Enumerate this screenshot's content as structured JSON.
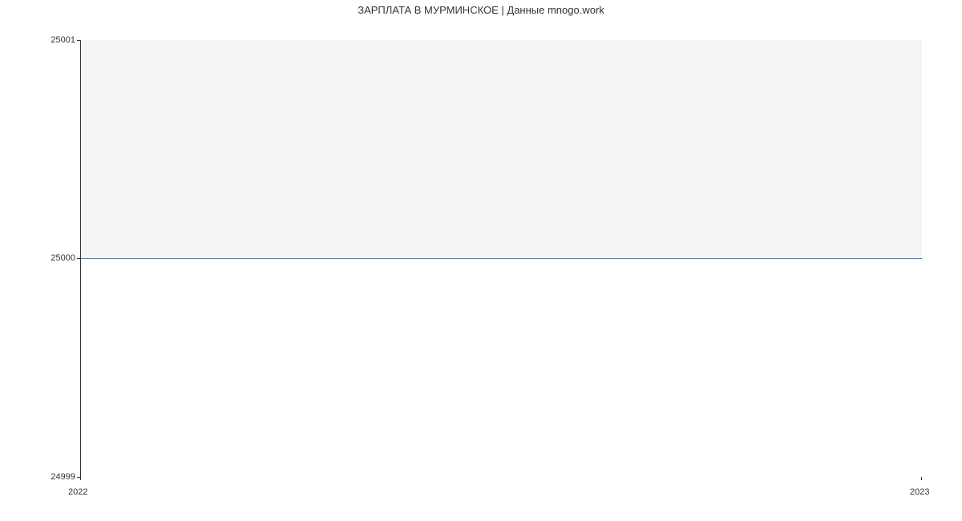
{
  "chart_data": {
    "type": "line",
    "title": "ЗАРПЛАТА В  МУРМИНСКОЕ | Данные mnogo.work",
    "x": [
      2022,
      2023
    ],
    "values": [
      25000,
      25000
    ],
    "xlabel": "",
    "ylabel": "",
    "ylim": [
      24999,
      25001
    ],
    "xlim": [
      2022,
      2023
    ],
    "y_ticks": [
      24999,
      25000,
      25001
    ],
    "x_ticks": [
      2022,
      2023
    ]
  }
}
